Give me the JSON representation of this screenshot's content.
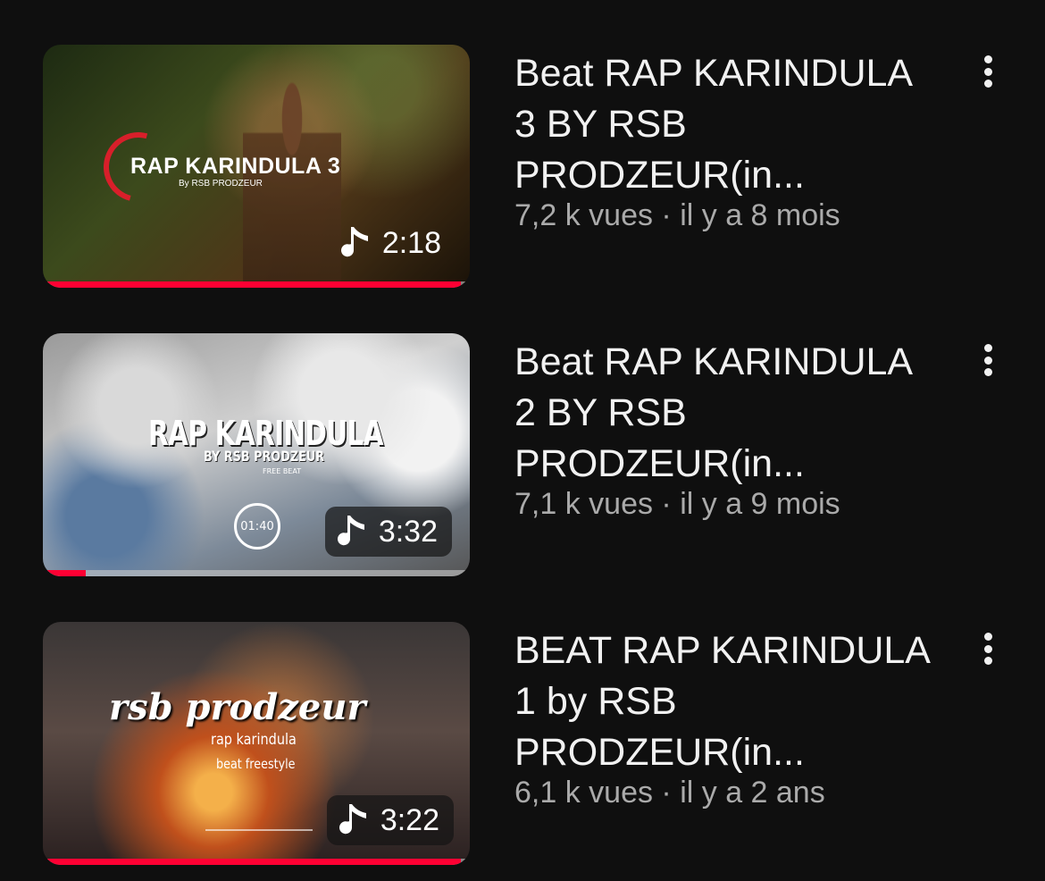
{
  "videos": [
    {
      "thumb_title": "RAP KARINDULA 3",
      "thumb_sub": "By RSB PRODZEUR",
      "duration": "2:18",
      "title": "Beat RAP KARINDULA 3 BY RSB PRODZEUR(in...",
      "stats": "7,2 k vues · il y a 8 mois",
      "watched_fraction": 0.98
    },
    {
      "thumb_title": "RAP KARINDULA",
      "thumb_sub": "BY RSB PRODZEUR",
      "thumb_tiny": "FREE BEAT",
      "thumb_timer": "01:40",
      "duration": "3:32",
      "title": "Beat RAP KARINDULA 2 BY RSB PRODZEUR(in...",
      "stats": "7,1 k vues · il y a 9 mois",
      "watched_fraction": 0.1
    },
    {
      "thumb_title": "rsb prodzeur",
      "thumb_sub": "rap karindula",
      "thumb_sub2": "beat freestyle",
      "duration": "3:22",
      "title": "BEAT RAP KARINDULA 1 by RSB PRODZEUR(in...",
      "stats": "6,1 k vues · il y a 2 ans",
      "watched_fraction": 0.98
    }
  ],
  "icons": {
    "duration_badge": "music-note-icon",
    "menu": "more-vert-icon"
  },
  "colors": {
    "background": "#0f0f0f",
    "progress": "#ff0033",
    "title": "#f1f1f1",
    "stats": "#aaaaaa"
  }
}
